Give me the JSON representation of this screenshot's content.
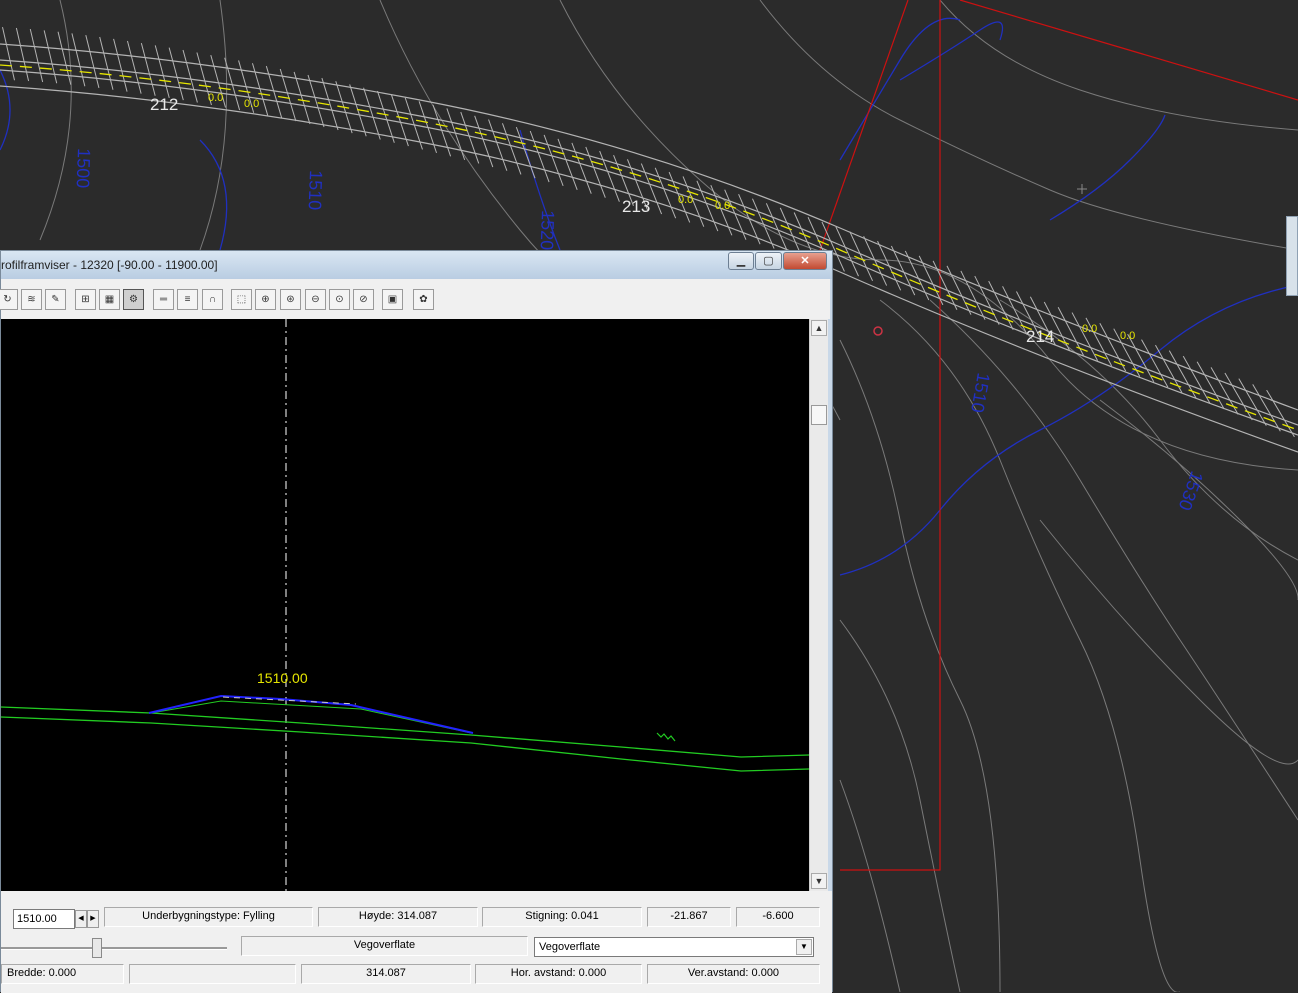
{
  "map": {
    "stations": [
      {
        "label": "212",
        "mark_left": "0.0",
        "mark_right": "0.0"
      },
      {
        "label": "213",
        "mark_left": "0.0",
        "mark_right": "0.0"
      },
      {
        "label": "214",
        "mark_left": "0.0",
        "mark_right": "0.0"
      }
    ],
    "contour_labels": [
      "1500",
      "1510",
      "1520",
      "1510",
      "1530"
    ]
  },
  "window": {
    "title": "rofilframviser - 12320  [-90.00 - 11900.00]",
    "controls": {
      "minimize": "▁",
      "maximize": "▢",
      "close": "✕"
    }
  },
  "toolbar": {
    "icons": [
      "refresh-icon",
      "layers-icon",
      "measure-icon",
      "grid-lines-icon",
      "grid-icon",
      "settings-icon",
      "ruler-icon",
      "xyz-icon",
      "magnet-icon",
      "zoom-window-icon",
      "zoom-in-icon",
      "zoom-center-icon",
      "zoom-out-icon",
      "zoom-extents-icon",
      "zoom-previous-icon",
      "book-icon",
      "palette-icon"
    ]
  },
  "profile": {
    "station_label": "1510.00",
    "colors": {
      "terrain": "#22cc22",
      "road": "#2222ff",
      "label": "#e6e600",
      "centerline": "#ffffff"
    }
  },
  "status": {
    "station_input": "1510.00",
    "underbygning": "Underbygningstype: Fylling",
    "hoyde": "Høyde: 314.087",
    "stigning": "Stigning: 0.041",
    "val1": "-21.867",
    "val2": "-6.600",
    "surface_label": "Vegoverflate",
    "surface_select": "Vegoverflate",
    "bredde": "Bredde: 0.000",
    "empty": "",
    "elevation": "314.087",
    "hor_avstand": "Hor. avstand: 0.000",
    "ver_avstand": "Ver.avstand: 0.000"
  }
}
